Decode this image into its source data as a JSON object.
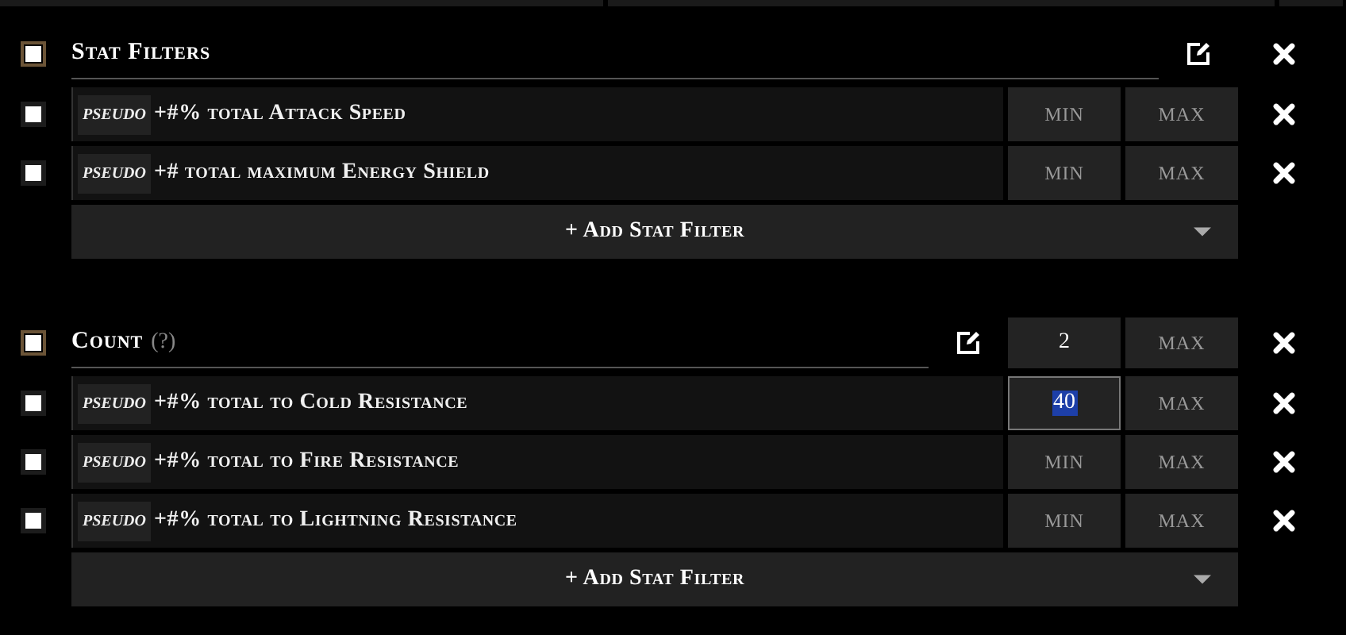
{
  "sections": [
    {
      "title": "Stat Filters",
      "filters": [
        {
          "tag": "PSEUDO",
          "text": "+#% total Attack Speed",
          "min": {
            "placeholder": "MIN",
            "focused": false
          },
          "max": {
            "placeholder": "MAX",
            "focused": false
          }
        },
        {
          "tag": "PSEUDO",
          "text": "+# total maximum Energy Shield",
          "min": {
            "placeholder": "MIN",
            "focused": false
          },
          "max": {
            "placeholder": "MAX",
            "focused": false
          }
        }
      ],
      "add_label": "+ Add Stat Filter"
    },
    {
      "title": "Count",
      "hint": "(?)",
      "header_min": {
        "value": "2",
        "focused": false
      },
      "header_max": {
        "placeholder": "MAX",
        "focused": false
      },
      "filters": [
        {
          "tag": "PSEUDO",
          "text": "+#% total to Cold Resistance",
          "min": {
            "value": "40",
            "focused": true
          },
          "max": {
            "placeholder": "MAX",
            "focused": false
          }
        },
        {
          "tag": "PSEUDO",
          "text": "+#% total to Fire Resistance",
          "min": {
            "placeholder": "MIN",
            "focused": false
          },
          "max": {
            "placeholder": "MAX",
            "focused": false
          }
        },
        {
          "tag": "PSEUDO",
          "text": "+#% total to Lightning Resistance",
          "min": {
            "placeholder": "MIN",
            "focused": false
          },
          "max": {
            "placeholder": "MAX",
            "focused": false
          }
        }
      ],
      "add_label": "+ Add Stat Filter"
    }
  ]
}
